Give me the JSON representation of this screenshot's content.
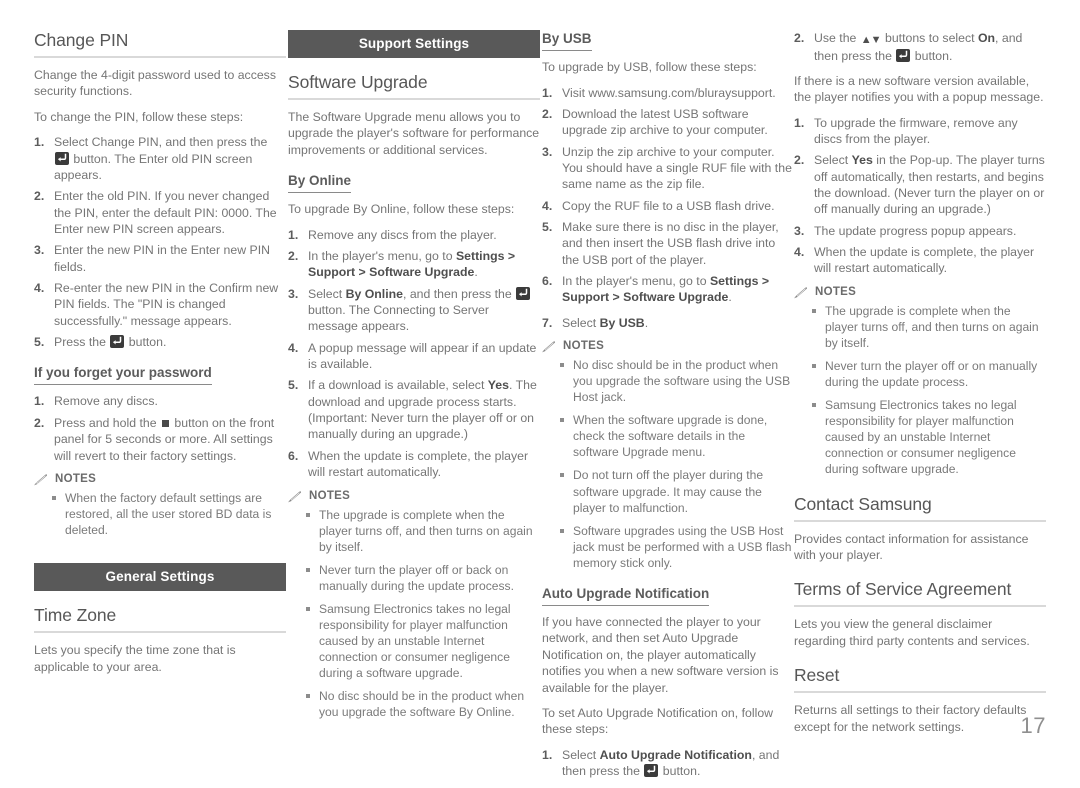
{
  "page": {
    "number": "17",
    "colors": {
      "section_bar_bg": "#595959",
      "body_text": "#757575",
      "heading_text": "#575757",
      "rule": "#d9d9d9"
    }
  },
  "icons": {
    "enter_button": "enter-button-icon",
    "stop_button": "stop-button-icon",
    "up_down_buttons": "up-down-arrows-icon",
    "notes_pencil": "pencil-icon"
  },
  "column1": {
    "change_pin": {
      "heading": "Change PIN",
      "intro1": "Change the 4-digit password used to access security functions.",
      "intro2": "To change the PIN, follow these steps:",
      "steps": [
        {
          "pre": "Select Change PIN, and then press the ",
          "icon": "enter",
          "post": " button. The Enter old PIN screen appears."
        },
        {
          "pre": "Enter the old PIN. If you never changed the PIN, enter the default PIN: 0000. The Enter new PIN screen appears.",
          "icon": "",
          "post": ""
        },
        {
          "pre": "Enter the new PIN in the Enter new PIN fields.",
          "icon": "",
          "post": ""
        },
        {
          "pre": "Re-enter the new PIN in the Confirm new PIN fields. The \"PIN is changed successfully.\" message appears.",
          "icon": "",
          "post": ""
        },
        {
          "pre": "Press the ",
          "icon": "enter",
          "post": " button."
        }
      ]
    },
    "forgot_password": {
      "heading": "If you forget your password",
      "steps": [
        {
          "pre": "Remove any discs.",
          "icon": "",
          "post": ""
        },
        {
          "pre": "Press and hold the ",
          "icon": "stop",
          "post": " button on the front panel for 5 seconds or more. All settings will revert to their factory settings."
        }
      ]
    },
    "notes": {
      "title": "NOTES",
      "items": [
        "When the factory default settings are restored, all the user stored BD data is deleted."
      ]
    },
    "general_settings_bar": "General Settings",
    "time_zone": {
      "heading": "Time Zone",
      "body": "Lets you specify the time zone that is applicable to your area."
    }
  },
  "column2": {
    "support_settings_bar": "Support Settings",
    "software_upgrade": {
      "heading": "Software Upgrade",
      "body": "The Software Upgrade menu allows you to upgrade the player's software for performance improvements or additional services."
    },
    "by_online": {
      "heading": "By Online",
      "intro": "To upgrade By Online, follow these steps:",
      "steps": [
        {
          "pre": "Remove any discs from the player.",
          "icon": "",
          "post": ""
        },
        {
          "pre": "In the player's menu, go to <b>Settings &gt; Support &gt; Software Upgrade</b>.",
          "icon": "",
          "post": "",
          "html": true
        },
        {
          "pre": "Select <b>By Online</b>, and then press the ",
          "icon": "enter",
          "post": " button. The Connecting to Server message appears.",
          "html": true
        },
        {
          "pre": "A popup message will appear if an update is available.",
          "icon": "",
          "post": ""
        },
        {
          "pre": "If a download is available, select <b>Yes</b>. The download and upgrade process starts. (Important: Never turn the player off or on manually during an upgrade.)",
          "icon": "",
          "post": "",
          "html": true
        },
        {
          "pre": "When the update is complete, the player will restart automatically.",
          "icon": "",
          "post": ""
        }
      ]
    },
    "notes": {
      "title": "NOTES",
      "items": [
        "The upgrade is complete when the player turns off, and then turns on again by itself.",
        "Never turn the player off or back on manually during the update process.",
        "Samsung Electronics takes no legal responsibility for player malfunction caused by an unstable Internet connection or consumer negligence during a software upgrade.",
        "No disc should be in the product when you upgrade the software By Online."
      ]
    }
  },
  "column3": {
    "by_usb": {
      "heading": "By USB",
      "intro": "To upgrade by USB, follow these steps:",
      "steps": [
        {
          "pre": "Visit www.samsung.com/bluraysupport.",
          "icon": "",
          "post": ""
        },
        {
          "pre": "Download the latest USB software upgrade zip archive to your computer.",
          "icon": "",
          "post": ""
        },
        {
          "pre": "Unzip the zip archive to your computer. You should have a single RUF file with the same name as the zip file.",
          "icon": "",
          "post": ""
        },
        {
          "pre": "Copy the RUF file to a USB flash drive.",
          "icon": "",
          "post": ""
        },
        {
          "pre": "Make sure there is no disc in the player, and then insert the USB flash drive into the USB port of the player.",
          "icon": "",
          "post": ""
        },
        {
          "pre": "In the player's menu, go to <b>Settings &gt; Support &gt; Software Upgrade</b>.",
          "icon": "",
          "post": "",
          "html": true
        }
      ],
      "step7": {
        "pre": "Select <b>By USB</b>.",
        "icon": "",
        "post": "",
        "html": true
      }
    },
    "notes": {
      "title": "NOTES",
      "items": [
        "No disc should be in the product when you upgrade the software using the USB Host jack.",
        "When the software upgrade is done, check the software details in the software Upgrade menu.",
        "Do not turn off the player during the software upgrade. It may cause the player to malfunction.",
        "Software upgrades using the USB Host jack must be performed with a USB flash memory stick only."
      ]
    },
    "auto_upgrade": {
      "heading": "Auto Upgrade Notification",
      "body1": "If you have connected the player to your network, and then set Auto Upgrade Notification on, the player automatically notifies you when a new software version is available for the player.",
      "body2": "To set Auto Upgrade Notification on, follow these steps:",
      "step1": {
        "pre": "Select <b>Auto Upgrade Notification</b>, and then press the ",
        "icon": "enter",
        "post": " button.",
        "html": true
      }
    }
  },
  "column4": {
    "auto_upgrade_cont": {
      "step2": {
        "pre": "Use the ",
        "icon": "updown",
        "mid": " buttons to select <b>On</b>, and then press the ",
        "icon2": "enter",
        "post": " button.",
        "html": true
      },
      "body": "If there is a new software version available, the player notifies you with a popup message.",
      "steps": [
        {
          "pre": "To upgrade the firmware, remove any discs from the player.",
          "icon": "",
          "post": ""
        },
        {
          "pre": "Select <b>Yes</b> in the Pop-up. The player turns off automatically, then restarts, and begins the download. (Never turn the player on or off manually during an upgrade.)",
          "icon": "",
          "post": "",
          "html": true
        },
        {
          "pre": "The update progress popup appears.",
          "icon": "",
          "post": ""
        },
        {
          "pre": "When the update is complete, the player will restart automatically.",
          "icon": "",
          "post": ""
        }
      ]
    },
    "notes": {
      "title": "NOTES",
      "items": [
        "The upgrade is complete when the player turns off, and then turns on again by itself.",
        "Never turn the player off or on manually during the update process.",
        "Samsung Electronics takes no legal responsibility for player malfunction caused by an unstable Internet connection or consumer negligence during software upgrade."
      ]
    },
    "contact_samsung": {
      "heading": "Contact Samsung",
      "body": "Provides contact information for assistance with your player."
    },
    "terms_of_service": {
      "heading": "Terms of Service Agreement",
      "body": "Lets you view the general disclaimer regarding third party contents and services."
    },
    "reset": {
      "heading": "Reset",
      "body": "Returns all settings to their factory defaults except for the network settings."
    }
  }
}
